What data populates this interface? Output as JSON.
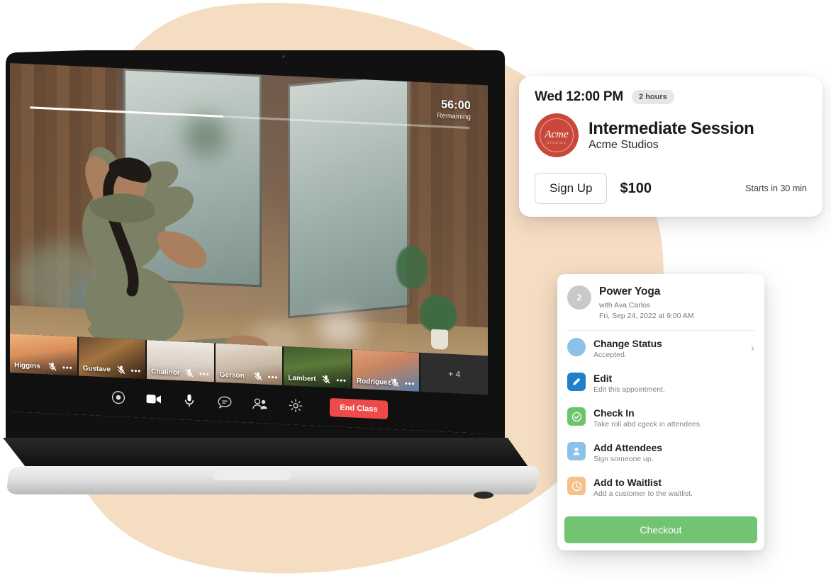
{
  "theme": {
    "blob_color": "#f5ddc2",
    "accent_red": "#ee4a4a",
    "accent_green": "#72c472",
    "brand_red": "#c9483a",
    "status_blue": "#8cc2ea",
    "edit_blue": "#1e7fcb",
    "checkin_green": "#6cc46c",
    "attendee_blue": "#8cc2ea",
    "waitlist_orange": "#f5c08a"
  },
  "video": {
    "timer_value": "56:00",
    "timer_label": "Remaining",
    "progress_percent": 44,
    "grid_icon": "grid-layout-icon",
    "thumbnails": [
      {
        "name": "Higgins",
        "dots": "•••"
      },
      {
        "name": "Gustave",
        "dots": "•••"
      },
      {
        "name": "Chalinor",
        "dots": "•••"
      },
      {
        "name": "Gerson",
        "dots": "•••"
      },
      {
        "name": "Lambert",
        "dots": "•••"
      },
      {
        "name": "Rodriguez",
        "dots": "•••"
      }
    ],
    "overflow_label": "+ 4",
    "controls": [
      {
        "icon": "record-icon",
        "name": "record-button"
      },
      {
        "icon": "video-camera-icon",
        "name": "camera-button"
      },
      {
        "icon": "microphone-icon",
        "name": "microphone-button"
      },
      {
        "icon": "chat-bubble-icon",
        "name": "chat-button"
      },
      {
        "icon": "participants-icon",
        "name": "participants-button"
      },
      {
        "icon": "gear-icon",
        "name": "settings-button"
      }
    ],
    "end_class_label": "End Class"
  },
  "session_card": {
    "time": "Wed 12:00 PM",
    "duration_badge": "2 hours",
    "logo_text": "Acme",
    "logo_sub": "STUDIOS",
    "title": "Intermediate Session",
    "studio": "Acme Studios",
    "signup_label": "Sign Up",
    "price": "$100",
    "starts_in": "Starts in 30 min"
  },
  "menu_card": {
    "avatar_count": "2",
    "title": "Power Yoga",
    "instructor": "with Ava Carlos",
    "datetime": "Fri, Sep 24, 2022 at 9:00 AM",
    "items": [
      {
        "label": "Change Status",
        "desc": "Accepted.",
        "icon": "status-circle-icon",
        "shape": "circle",
        "color": "#8cc2ea",
        "chevron": "›"
      },
      {
        "label": "Edit",
        "desc": "Edit this appointment.",
        "icon": "pencil-icon",
        "shape": "square",
        "color": "#1e7fcb",
        "chevron": ""
      },
      {
        "label": "Check In",
        "desc": "Take roll abd cgeck in attendees.",
        "icon": "check-circle-icon",
        "shape": "square",
        "color": "#6cc46c",
        "chevron": ""
      },
      {
        "label": "Add Attendees",
        "desc": "Sign someone up.",
        "icon": "person-add-icon",
        "shape": "square",
        "color": "#8cc2ea",
        "chevron": ""
      },
      {
        "label": "Add to Waitlist",
        "desc": "Add a customer to the waitlist.",
        "icon": "clock-icon",
        "shape": "square",
        "color": "#f5c08a",
        "chevron": ""
      }
    ],
    "checkout_label": "Checkout"
  }
}
